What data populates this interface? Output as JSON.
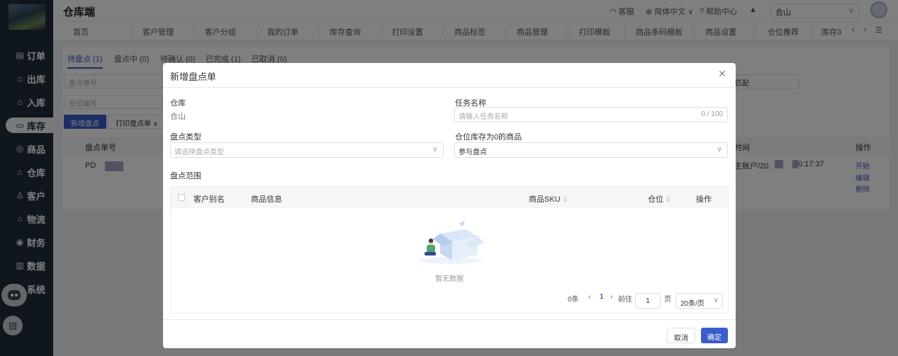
{
  "app": {
    "title": "仓库端"
  },
  "header": {
    "service": "客服",
    "language": "简体中文",
    "help": "帮助中心",
    "warehouse": "合山"
  },
  "sidebar": {
    "items": [
      {
        "label": "订单",
        "icon": "order-icon"
      },
      {
        "label": "出库",
        "icon": "outbound-icon"
      },
      {
        "label": "入库",
        "icon": "inbound-icon"
      },
      {
        "label": "库存",
        "icon": "inventory-icon"
      },
      {
        "label": "商品",
        "icon": "product-icon"
      },
      {
        "label": "仓库",
        "icon": "warehouse-icon"
      },
      {
        "label": "客户",
        "icon": "customer-icon"
      },
      {
        "label": "物流",
        "icon": "logistics-icon"
      },
      {
        "label": "财务",
        "icon": "finance-icon"
      },
      {
        "label": "数据",
        "icon": "data-icon"
      },
      {
        "label": "系统",
        "icon": "system-icon"
      }
    ],
    "active": "库存"
  },
  "tabs": [
    "首页",
    "客户管理",
    "客户分组",
    "我的订单",
    "库存查询",
    "打印设置",
    "商品标签",
    "商品管理",
    "打印模板",
    "商品条码模板",
    "商品设置",
    "仓位推荐",
    "库存3"
  ],
  "page": {
    "subtabs": [
      "待盘点 (1)",
      "盘点中 (0)",
      "待确认 (0)",
      "已完成 (1)",
      "已取消 (0)"
    ],
    "filter_order_no": "盘点单号",
    "filter_location": "仓位编号",
    "filter_match_suffix": "匹配",
    "new_button": "新增盘点",
    "print_button": "打印盘点单",
    "col_order_no": "盘点单号",
    "col_time": "时间",
    "col_action": "操作",
    "row_prefix": "PD",
    "row_account": "主账户/20.",
    "row_time": "0:17:37",
    "actions": [
      "开始",
      "编辑",
      "删除"
    ]
  },
  "modal": {
    "title": "新增盘点单",
    "warehouse_label": "仓库",
    "warehouse_value": "合山",
    "task_name_label": "任务名称",
    "task_name_placeholder": "请输入任务名称",
    "task_name_count": "0 / 100",
    "type_label": "盘点类型",
    "type_placeholder": "请选择盘点类型",
    "zero_stock_label": "仓位库存为0的商品",
    "zero_stock_value": "参与盘点",
    "range_label": "盘点范围",
    "table_headers": {
      "customer": "客户别名",
      "product": "商品信息",
      "sku": "商品SKU",
      "location": "仓位",
      "action": "操作"
    },
    "empty_text": "暂无数据",
    "pager": {
      "total": "0条",
      "current_page": "1",
      "goto": "前往",
      "page_input": "1",
      "page_unit": "页",
      "page_size": "20条/页"
    },
    "cancel": "取消",
    "confirm": "确定"
  }
}
